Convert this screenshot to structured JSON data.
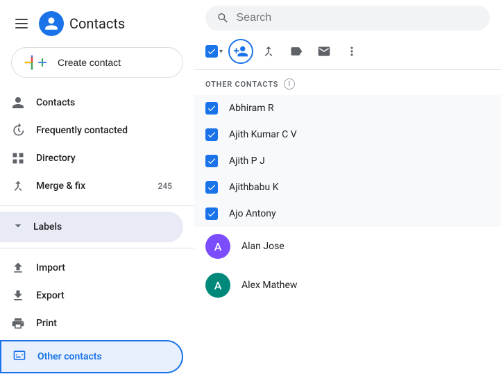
{
  "app": {
    "title": "Contacts"
  },
  "search": {
    "placeholder": "Search"
  },
  "sidebar": {
    "create_btn": "Create contact",
    "nav_items": [
      {
        "id": "contacts",
        "label": "Contacts",
        "icon": "person"
      },
      {
        "id": "frequently-contacted",
        "label": "Frequently contacted",
        "icon": "history"
      },
      {
        "id": "directory",
        "label": "Directory",
        "icon": "grid"
      },
      {
        "id": "merge-fix",
        "label": "Merge & fix",
        "icon": "merge",
        "badge": "245"
      }
    ],
    "labels_label": "Labels",
    "utility_items": [
      {
        "id": "import",
        "label": "Import",
        "icon": "upload"
      },
      {
        "id": "export",
        "label": "Export",
        "icon": "download"
      },
      {
        "id": "print",
        "label": "Print",
        "icon": "print"
      }
    ],
    "other_contacts_label": "Other contacts"
  },
  "toolbar": {
    "add_to_contacts_label": "Add to contacts",
    "merge_label": "Merge",
    "label_label": "Label",
    "send_email_label": "Send email",
    "more_label": "More"
  },
  "section": {
    "title": "OTHER CONTACTS"
  },
  "contacts": [
    {
      "id": 1,
      "name": "Abhiram R",
      "checked": true,
      "avatar": null
    },
    {
      "id": 2,
      "name": "Ajith Kumar C V",
      "checked": true,
      "avatar": null
    },
    {
      "id": 3,
      "name": "Ajith P J",
      "checked": true,
      "avatar": null
    },
    {
      "id": 4,
      "name": "Ajithbabu K",
      "checked": true,
      "avatar": null
    },
    {
      "id": 5,
      "name": "Ajo Antony",
      "checked": true,
      "avatar": null
    },
    {
      "id": 6,
      "name": "Alan Jose",
      "checked": false,
      "avatar": "A",
      "avatar_color": "#7c4dff"
    },
    {
      "id": 7,
      "name": "Alex Mathew",
      "checked": false,
      "avatar": "A",
      "avatar_color": "#00897b"
    }
  ],
  "colors": {
    "primary": "#1a73e8",
    "text_primary": "#202124",
    "text_secondary": "#5f6368",
    "bg_highlight": "#e8f0fe",
    "border": "#dadce0"
  }
}
